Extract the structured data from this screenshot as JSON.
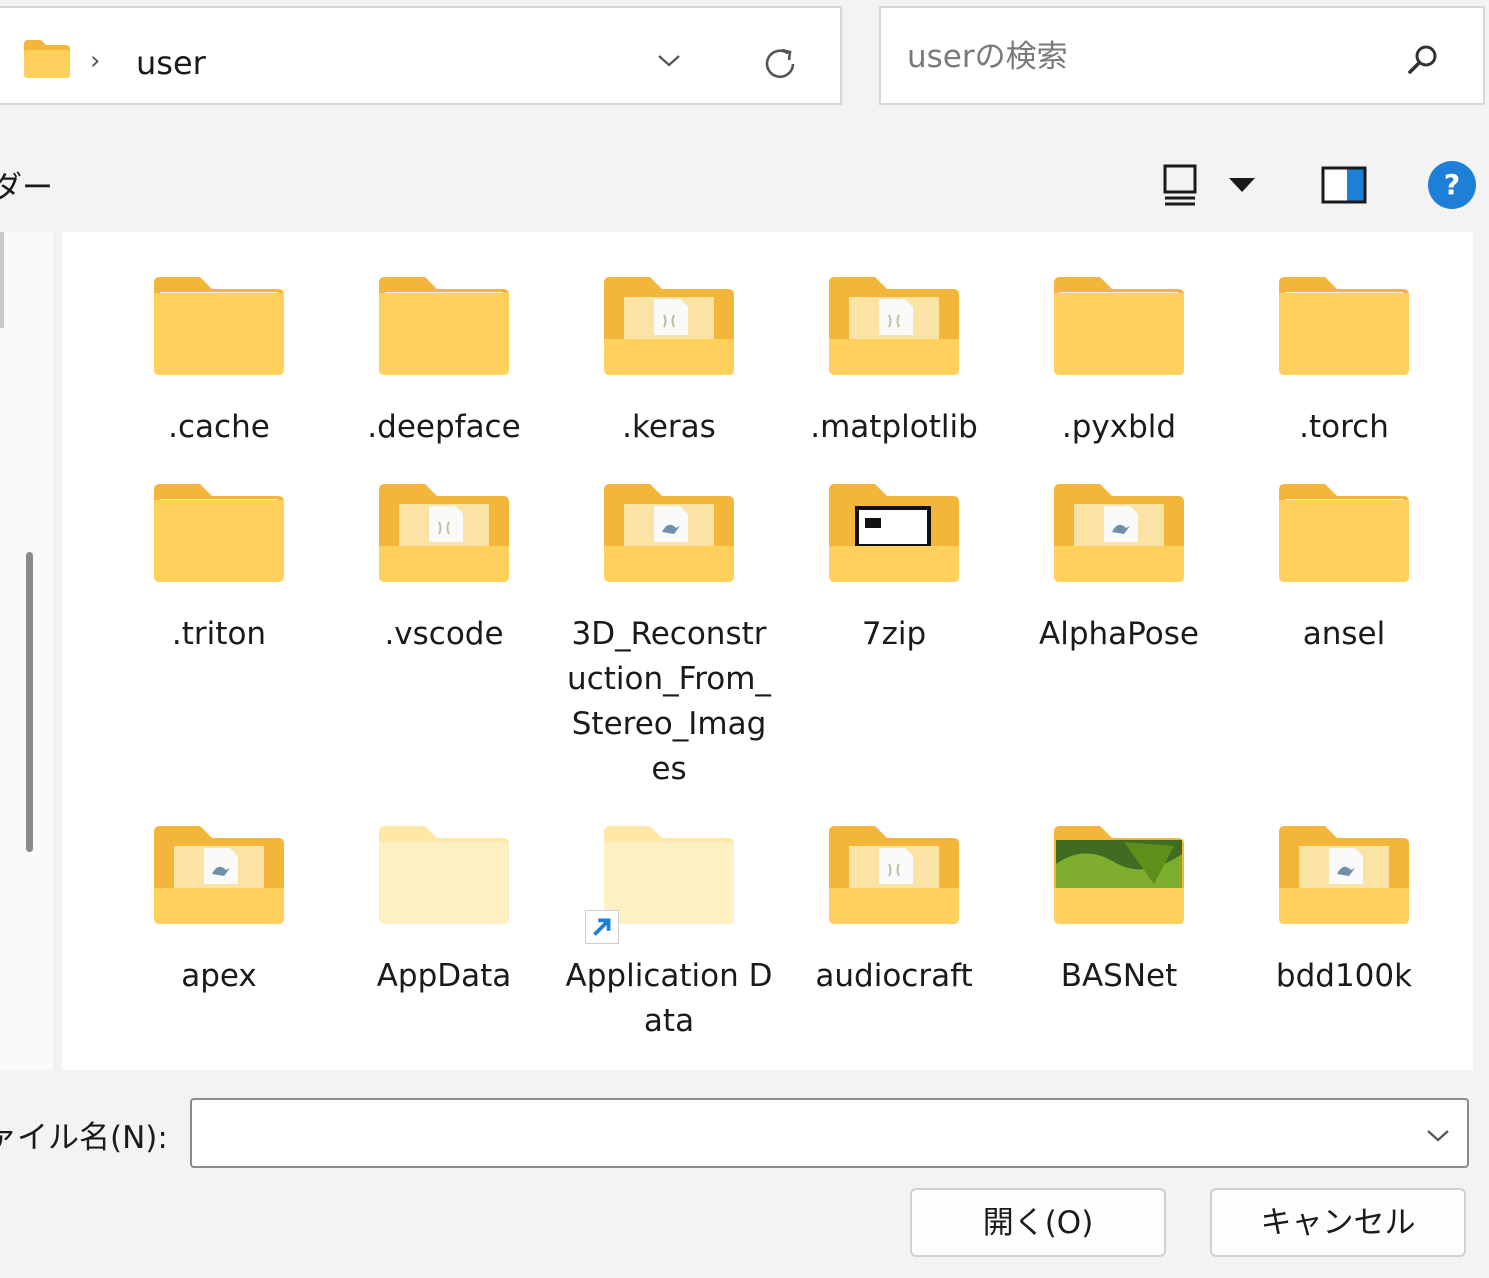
{
  "address": {
    "separator": "›",
    "path": "user"
  },
  "search": {
    "placeholder": "userの検索"
  },
  "commandbar": {
    "label": "ルダー",
    "help_glyph": "?"
  },
  "colors": {
    "accent": "#1e7fd9",
    "folder": "#ffd15c",
    "folder_dark": "#f4b63a"
  },
  "files": [
    {
      "name": ".cache",
      "icon": "folder-icon"
    },
    {
      "name": ".deepface",
      "icon": "folder-icon"
    },
    {
      "name": ".keras",
      "icon": "folder-document-icon"
    },
    {
      "name": ".matplotlib",
      "icon": "folder-document-icon"
    },
    {
      "name": ".pyxbld",
      "icon": "folder-icon"
    },
    {
      "name": ".torch",
      "icon": "folder-icon"
    },
    {
      "name": ".triton",
      "icon": "folder-icon"
    },
    {
      "name": ".vscode",
      "icon": "folder-document-icon"
    },
    {
      "name": "3D_Reconstruction_From_Stereo_Images",
      "icon": "folder-app-icon"
    },
    {
      "name": "7zip",
      "icon": "folder-window-icon"
    },
    {
      "name": "AlphaPose",
      "icon": "folder-app-icon"
    },
    {
      "name": "ansel",
      "icon": "folder-icon"
    },
    {
      "name": "apex",
      "icon": "folder-app-icon"
    },
    {
      "name": "AppData",
      "icon": "folder-hidden-icon"
    },
    {
      "name": "Application Data",
      "icon": "folder-shortcut-icon"
    },
    {
      "name": "audiocraft",
      "icon": "folder-document-icon"
    },
    {
      "name": "BASNet",
      "icon": "folder-photo-icon"
    },
    {
      "name": "bdd100k",
      "icon": "folder-app-icon"
    }
  ],
  "filename": {
    "label": "ァイル名(N):",
    "value": ""
  },
  "buttons": {
    "open": "開く(O)",
    "cancel": "キャンセル"
  }
}
